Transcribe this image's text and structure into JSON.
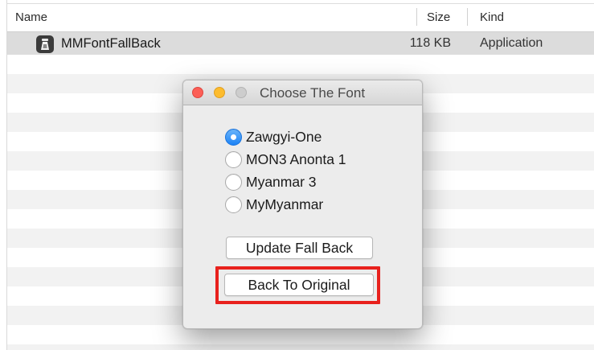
{
  "finder": {
    "columns": {
      "name": "Name",
      "size": "Size",
      "kind": "Kind"
    },
    "files": [
      {
        "name": "MMFontFallBack",
        "size": "118 KB",
        "kind": "Application",
        "icon": "app-icon"
      }
    ]
  },
  "dialog": {
    "title": "Choose The Font",
    "options": [
      {
        "label": "Zawgyi-One",
        "selected": true
      },
      {
        "label": "MON3 Anonta 1",
        "selected": false
      },
      {
        "label": "Myanmar 3",
        "selected": false
      },
      {
        "label": "MyMyanmar",
        "selected": false
      }
    ],
    "buttons": {
      "update": "Update Fall Back",
      "back": "Back To Original"
    }
  },
  "colors": {
    "highlight": "#e8211d",
    "radio_selected": "#1c82f5",
    "traffic_close": "#fc5f57",
    "traffic_minimize": "#fdbc2e"
  }
}
